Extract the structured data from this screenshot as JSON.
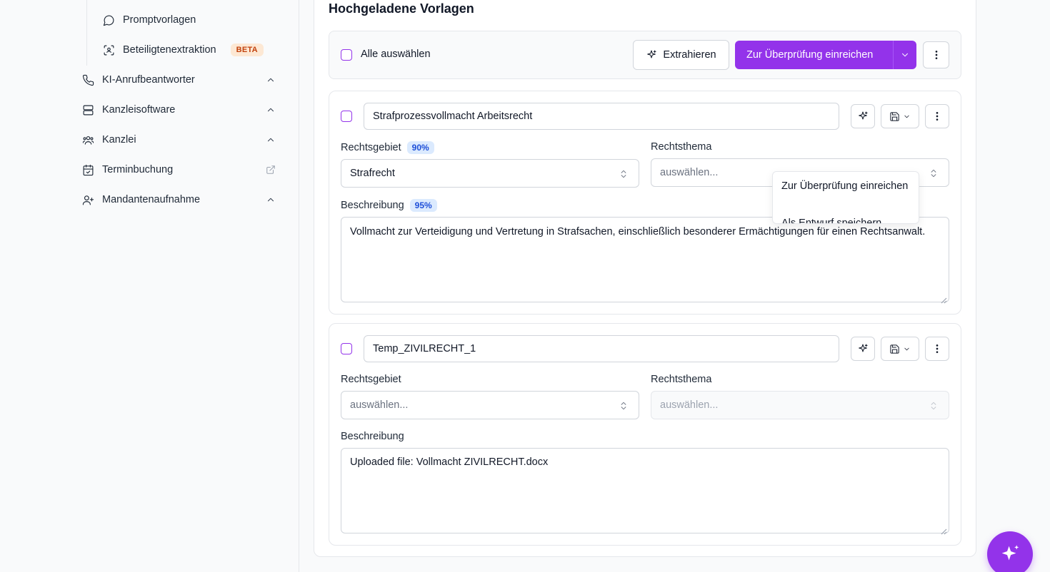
{
  "sidebar": {
    "sub_items": [
      {
        "label": "Promptvorlagen",
        "icon": "message-circle-icon"
      },
      {
        "label": "Beteiligtenextraktion",
        "icon": "scan-face-icon",
        "badge": "BETA"
      }
    ],
    "items": [
      {
        "label": "KI-Anrufbeantworter",
        "icon": "phone-icon",
        "trailing": "chevron-up-icon"
      },
      {
        "label": "Kanzleisoftware",
        "icon": "server-icon",
        "trailing": "chevron-up-icon"
      },
      {
        "label": "Kanzlei",
        "icon": "users-icon",
        "trailing": "chevron-up-icon"
      },
      {
        "label": "Terminbuchung",
        "icon": "calendar-check-icon",
        "trailing": "external-link-icon"
      },
      {
        "label": "Mandantenaufnahme",
        "icon": "user-plus-icon",
        "trailing": "chevron-up-icon"
      }
    ]
  },
  "main": {
    "title": "Hochgeladene Vorlagen",
    "toolbar": {
      "select_all_label": "Alle auswählen",
      "extract_label": "Extrahieren",
      "submit_label": "Zur Überprüfung einreichen"
    },
    "templates": [
      {
        "name": "Strafprozessvollmacht Arbeitsrecht",
        "rechtsgebiet_label": "Rechtsgebiet",
        "rechtsgebiet_confidence": "90%",
        "rechtsgebiet_value": "Strafrecht",
        "rechtsthema_label": "Rechtsthema",
        "rechtsthema_placeholder": "auswählen...",
        "beschreibung_label": "Beschreibung",
        "beschreibung_confidence": "95%",
        "beschreibung_value": "Vollmacht zur Verteidigung und Vertretung in Strafsachen, einschließlich besonderer Ermächtigungen für einen Rechtsanwalt."
      },
      {
        "name": "Temp_ZIVILRECHT_1",
        "rechtsgebiet_label": "Rechtsgebiet",
        "rechtsgebiet_placeholder": "auswählen...",
        "rechtsthema_label": "Rechtsthema",
        "rechtsthema_placeholder": "auswählen...",
        "beschreibung_label": "Beschreibung",
        "beschreibung_value": "Uploaded file: Vollmacht ZIVILRECHT.docx"
      }
    ],
    "dropdown": {
      "items": [
        "Zur Überprüfung einreichen",
        "Als Entwurf speichern"
      ]
    }
  },
  "colors": {
    "primary": "#9333ea",
    "badge_beta_bg": "#fde8d4",
    "badge_pct_bg": "#dbeafe"
  }
}
